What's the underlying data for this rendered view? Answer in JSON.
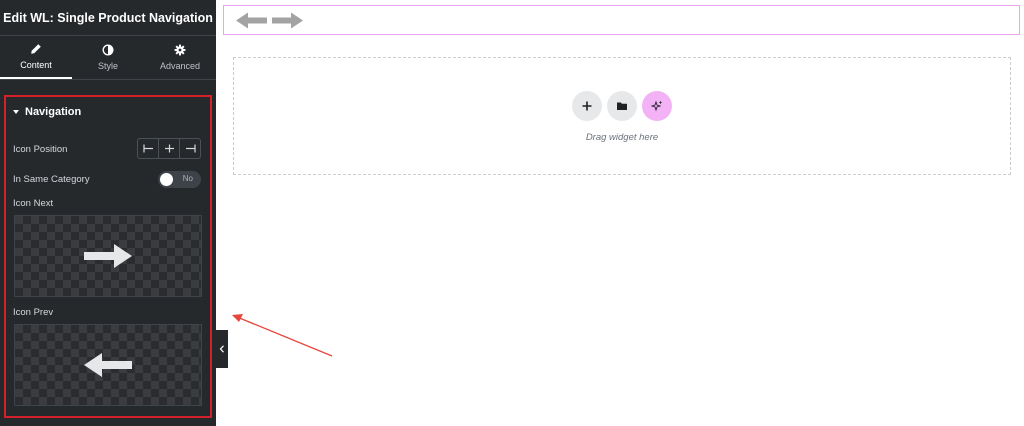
{
  "panel": {
    "title": "Edit WL: Single Product Navigation",
    "tabs": [
      {
        "label": "Content",
        "icon": "pencil-icon",
        "active": true
      },
      {
        "label": "Style",
        "icon": "half-circle-icon",
        "active": false
      },
      {
        "label": "Advanced",
        "icon": "gear-icon",
        "active": false
      }
    ],
    "section": {
      "title": "Navigation",
      "icon_position_label": "Icon Position",
      "icon_position_options": [
        "align-left-icon",
        "align-center-icon",
        "align-right-icon"
      ],
      "same_category_label": "In Same Category",
      "same_category_value": "No",
      "icon_next_label": "Icon Next",
      "icon_next_preview": "arrow-right-icon",
      "icon_prev_label": "Icon Prev",
      "icon_prev_preview": "arrow-left-icon"
    },
    "collapse_icon": "chevron-left-icon"
  },
  "canvas": {
    "widget_icons": [
      "arrow-left-icon",
      "arrow-right-icon"
    ],
    "dropzone": {
      "buttons": [
        "plus-icon",
        "folder-icon",
        "sparkle-icon"
      ],
      "text": "Drag widget here"
    }
  },
  "colors": {
    "panel_bg": "#26292c",
    "highlight_border": "#d3202b",
    "widget_border": "#e9a3ef",
    "ai_button": "#f3b2f6",
    "annotation_arrow": "#e8453c"
  }
}
